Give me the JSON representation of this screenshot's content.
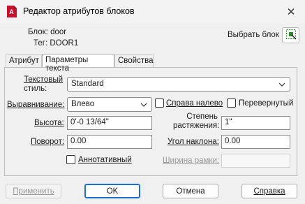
{
  "window": {
    "title": "Редактор атрибутов блоков",
    "close_glyph": "✕"
  },
  "block_info": {
    "block_label": "Блок: door",
    "tag_label": "Тег: DOOR1",
    "pick_block_label": "Выбрать блок"
  },
  "tabs": [
    {
      "label": "Атрибут"
    },
    {
      "label": "Параметры текста"
    },
    {
      "label": "Свойства"
    }
  ],
  "form": {
    "text_style_label_line1": "Текстовый",
    "text_style_label_line2": "стиль:",
    "text_style_value": "Standard",
    "justify_label": "Выравнивание:",
    "justify_value": "Влево",
    "backwards_label": "Справа налево",
    "upside_down_label": "Перевернутый",
    "height_label": "Высота:",
    "height_value": "0'-0 13/64\"",
    "width_factor_label_line1": "Степень",
    "width_factor_label_line2": "растяжения:",
    "width_factor_value": "1\"",
    "rotation_label": "Поворот:",
    "rotation_value": "0.00",
    "oblique_label": "Угол наклона:",
    "oblique_value": "0.00",
    "annotative_label": "Аннотативный",
    "boundary_width_label": "Ширина рамки:",
    "boundary_width_value": ""
  },
  "buttons": {
    "apply": "Применить",
    "ok": "OK",
    "cancel": "Отмена",
    "help": "Справка"
  },
  "colors": {
    "accent": "#1c6dd0",
    "app_icon": "#c8102e"
  }
}
